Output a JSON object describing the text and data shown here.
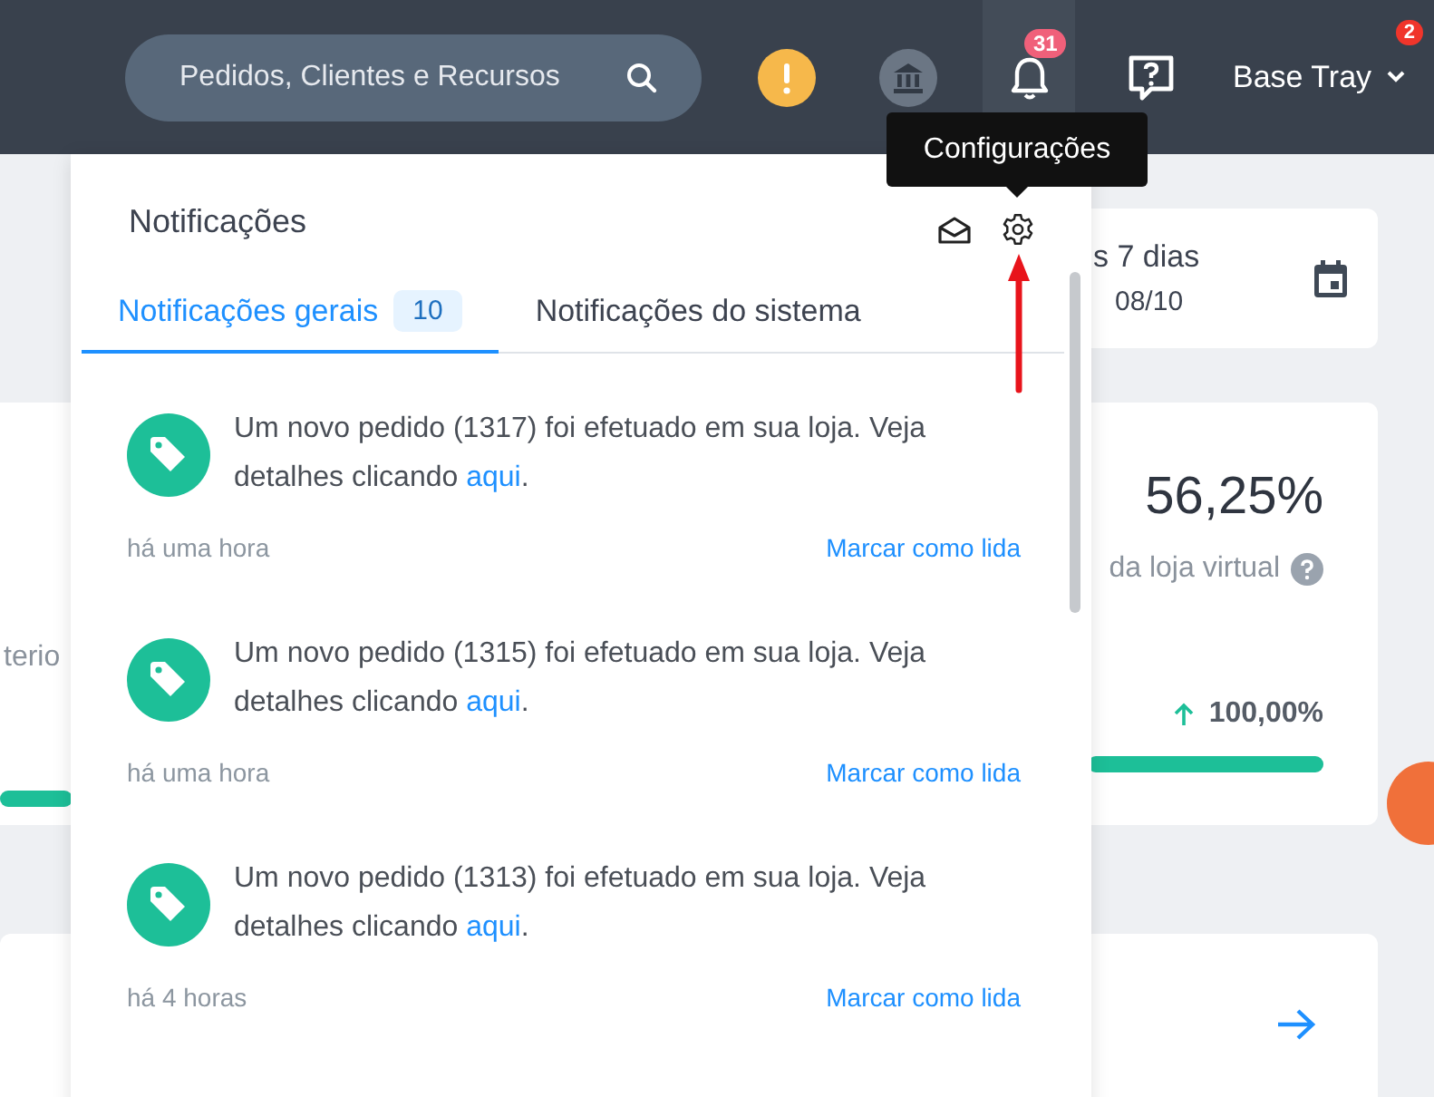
{
  "top_bar": {
    "search": {
      "placeholder": "Pedidos, Clientes e Recursos"
    },
    "notifications_badge": "31",
    "account": {
      "name": "Base Tray",
      "badge": "2"
    }
  },
  "tooltip": "Configurações",
  "background": {
    "period_text": "s 7 dias",
    "date_text": "08/10",
    "left_label": "terio",
    "left_bar": {
      "level": 1
    },
    "percentage": "56,25%",
    "percentage_label": "da loja virtual",
    "growth": "100,00%",
    "level": 1
  },
  "notifications": {
    "title": "Notificações",
    "tabs": [
      {
        "label": "Notificações gerais",
        "count": "10",
        "selected": true
      },
      {
        "label": "Notificações do sistema",
        "selected": false
      }
    ],
    "items": [
      {
        "text": "Um novo pedido (1317) foi efetuado em sua loja. Veja detalhes clicando ",
        "link": "aqui",
        "after": ".",
        "time": "há uma hora",
        "action": "Marcar como lida"
      },
      {
        "text": "Um novo pedido (1315) foi efetuado em sua loja. Veja detalhes clicando ",
        "link": "aqui",
        "after": ".",
        "time": "há uma hora",
        "action": "Marcar como lida"
      },
      {
        "text": "Um novo pedido (1313) foi efetuado em sua loja. Veja detalhes clicando ",
        "link": "aqui",
        "after": ".",
        "time": "há 4 horas",
        "action": "Marcar como lida"
      }
    ]
  }
}
